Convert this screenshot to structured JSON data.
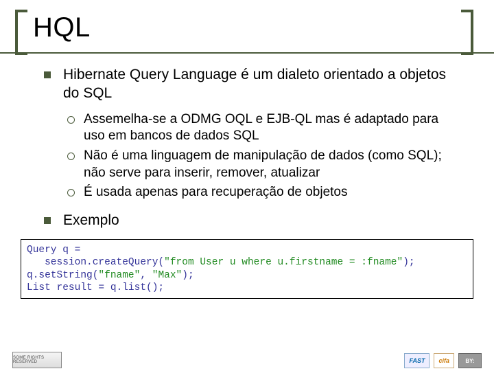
{
  "title": "HQL",
  "bullets": [
    {
      "text": "Hibernate Query Language é um dialeto orientado a objetos do SQL",
      "sub": [
        "Assemelha-se a ODMG OQL e EJB-QL mas é adaptado para uso em bancos de dados SQL",
        "Não é uma linguagem de manipulação de dados (como SQL); não serve para inserir, remover, atualizar",
        "É usada apenas para recuperação de objetos"
      ]
    },
    {
      "text": "Exemplo",
      "sub": []
    }
  ],
  "code": {
    "l1a": "Query q =",
    "l2a": "   session.createQuery(",
    "l2b": "\"from User u where u.firstname = :fname\"",
    "l2c": ");",
    "l3a": "q.setString(",
    "l3b": "\"fname\"",
    "l3c": ", ",
    "l3d": "\"Max\"",
    "l3e": ");",
    "l4a": "List result = q.list();"
  },
  "footer": {
    "cc": "SOME RIGHTS RESERVED",
    "fast": "FAST",
    "cifa": "cifa",
    "by": "BY:"
  }
}
